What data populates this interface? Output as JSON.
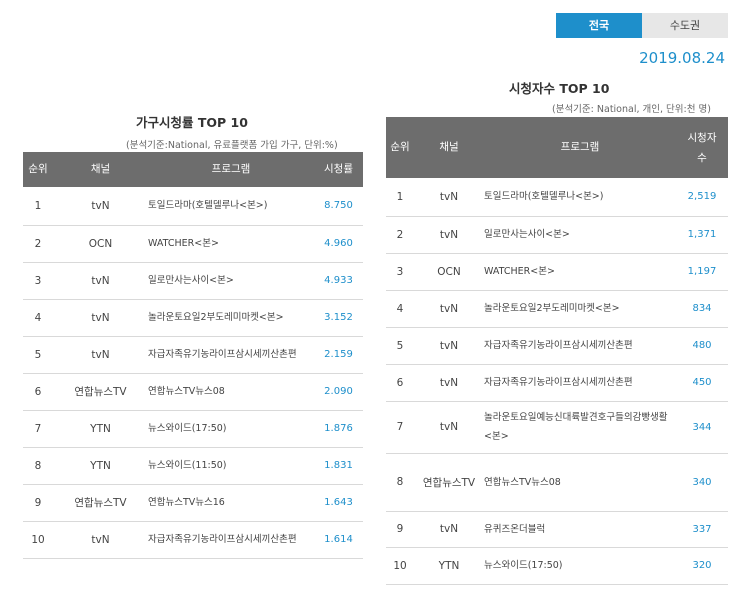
{
  "tabs": {
    "national": "전국",
    "capital": "수도권"
  },
  "date": "2019.08.24",
  "household": {
    "title": "가구시청률 TOP 10",
    "unit_note": "(분석기준:National, 유료플랫폼 가입 가구, 단위:%)",
    "headers": {
      "rank": "순위",
      "channel": "채널",
      "program": "프로그램",
      "value": "시청률"
    },
    "rows": [
      {
        "rank": "1",
        "channel": "tvN",
        "program": "토일드라마(호텔델루나<본>)",
        "value": "8.750"
      },
      {
        "rank": "2",
        "channel": "OCN",
        "program": "WATCHER<본>",
        "value": "4.960"
      },
      {
        "rank": "3",
        "channel": "tvN",
        "program": "일로만사는사이<본>",
        "value": "4.933"
      },
      {
        "rank": "4",
        "channel": "tvN",
        "program": "놀라운토요일2부도레미마켓<본>",
        "value": "3.152"
      },
      {
        "rank": "5",
        "channel": "tvN",
        "program": "자급자족유기농라이프삼시세끼산촌편",
        "value": "2.159"
      },
      {
        "rank": "6",
        "channel": "연합뉴스TV",
        "program": "연합뉴스TV뉴스08",
        "value": "2.090"
      },
      {
        "rank": "7",
        "channel": "YTN",
        "program": "뉴스와이드(17:50)",
        "value": "1.876"
      },
      {
        "rank": "8",
        "channel": "YTN",
        "program": "뉴스와이드(11:50)",
        "value": "1.831"
      },
      {
        "rank": "9",
        "channel": "연합뉴스TV",
        "program": "연합뉴스TV뉴스16",
        "value": "1.643"
      },
      {
        "rank": "10",
        "channel": "tvN",
        "program": "자급자족유기농라이프삼시세끼산촌편",
        "value": "1.614"
      }
    ]
  },
  "viewers": {
    "title": "시청자수 TOP 10",
    "unit_note": "(분석기준: National, 개인, 단위:천 명)",
    "headers": {
      "rank": "순위",
      "channel": "채널",
      "program": "프로그램",
      "value": "시청자수"
    },
    "rows": [
      {
        "rank": "1",
        "channel": "tvN",
        "program": "토일드라마(호텔델루나<본>)",
        "value": "2,519"
      },
      {
        "rank": "2",
        "channel": "tvN",
        "program": "일로만사는사이<본>",
        "value": "1,371"
      },
      {
        "rank": "3",
        "channel": "OCN",
        "program": "WATCHER<본>",
        "value": "1,197"
      },
      {
        "rank": "4",
        "channel": "tvN",
        "program": "놀라운토요일2부도레미마켓<본>",
        "value": "834"
      },
      {
        "rank": "5",
        "channel": "tvN",
        "program": "자급자족유기농라이프삼시세끼산촌편",
        "value": "480"
      },
      {
        "rank": "6",
        "channel": "tvN",
        "program": "자급자족유기농라이프삼시세끼산촌편",
        "value": "450"
      },
      {
        "rank": "7",
        "channel": "tvN",
        "program": "놀라운토요일예능신대륙발견호구들의감빵생활<본>",
        "value": "344"
      },
      {
        "rank": "8",
        "channel": "연합뉴스TV",
        "program": "연합뉴스TV뉴스08",
        "value": "340"
      },
      {
        "rank": "9",
        "channel": "tvN",
        "program": "유퀴즈온더블럭",
        "value": "337"
      },
      {
        "rank": "10",
        "channel": "YTN",
        "program": "뉴스와이드(17:50)",
        "value": "320"
      }
    ]
  },
  "colors": {
    "accent": "#1e8fcb",
    "header_bg": "#6d6d6d",
    "tab_inactive": "#e7e7e7"
  }
}
